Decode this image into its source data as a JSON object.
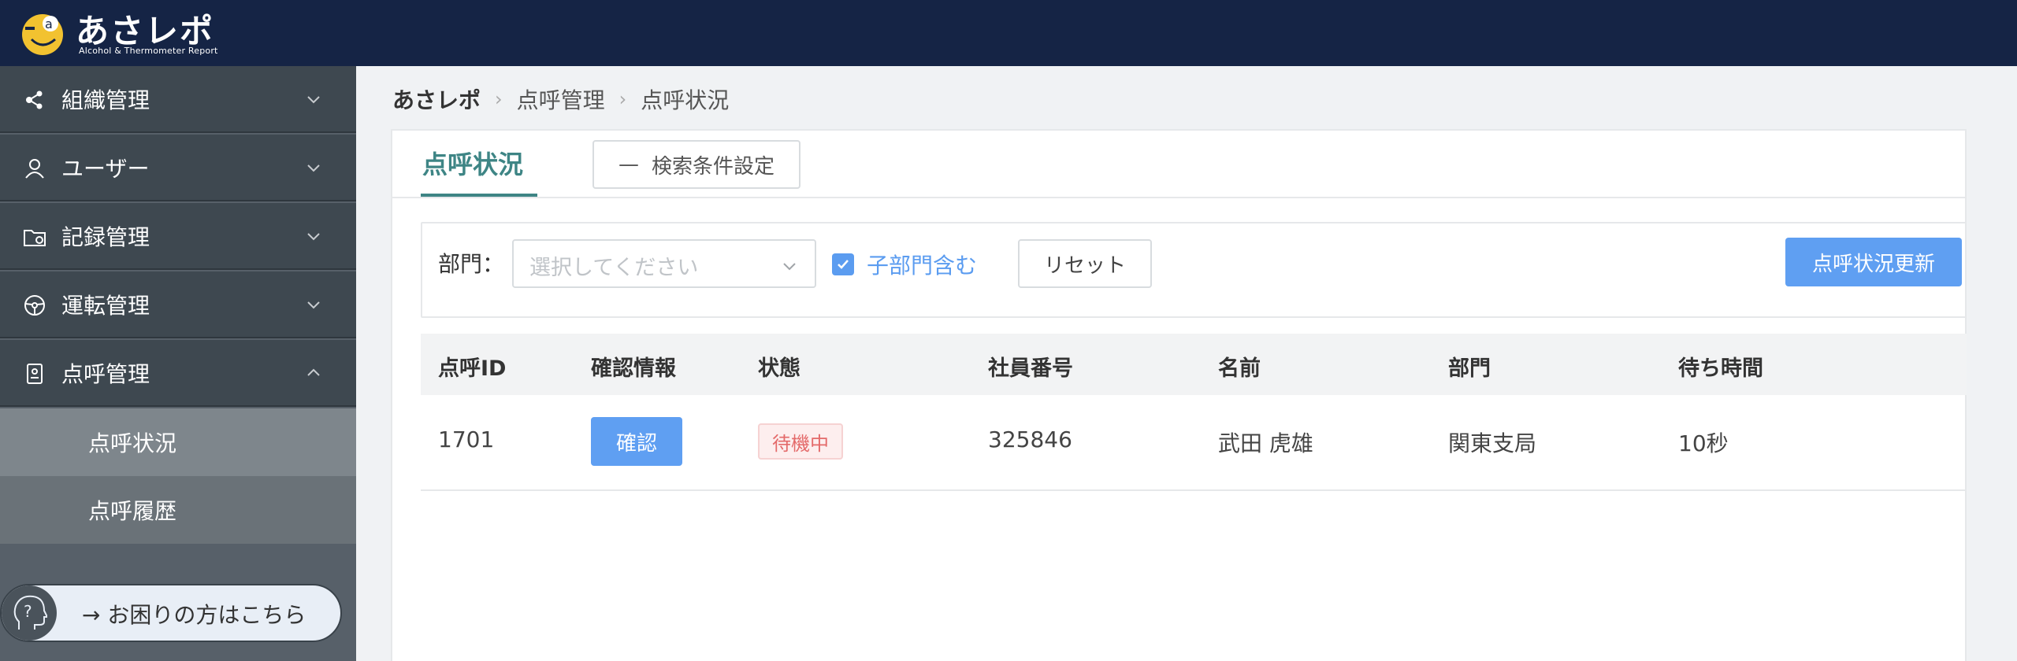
{
  "header": {
    "app_title": "あさレポ",
    "app_subtitle": "Alcohol & Thermometer Report",
    "logo_icon": "asarepo-logo"
  },
  "sidebar": {
    "items": [
      {
        "label": "組織管理",
        "icon": "organization-icon",
        "expanded": false
      },
      {
        "label": "ユーザー",
        "icon": "user-icon",
        "expanded": false
      },
      {
        "label": "記録管理",
        "icon": "folder-settings-icon",
        "expanded": false
      },
      {
        "label": "運転管理",
        "icon": "steering-wheel-icon",
        "expanded": false
      },
      {
        "label": "点呼管理",
        "icon": "id-badge-icon",
        "expanded": true
      }
    ],
    "subitems": [
      {
        "label": "点呼状況",
        "active": true
      },
      {
        "label": "点呼履歴",
        "active": false
      }
    ],
    "help": {
      "label": "→ お困りの方はこちら",
      "icon": "help-head-icon"
    }
  },
  "breadcrumb": [
    "あさレポ",
    "点呼管理",
    "点呼状況"
  ],
  "main": {
    "tab_label": "点呼状況",
    "search_settings_label": "検索条件設定",
    "filter": {
      "dept_label": "部門：",
      "dept_placeholder": "選択してください",
      "include_sub_label": "子部門含む",
      "include_sub_checked": true,
      "reset_label": "リセット",
      "refresh_label": "点呼状況更新"
    },
    "table": {
      "headers": [
        "点呼ID",
        "確認情報",
        "状態",
        "社員番号",
        "名前",
        "部門",
        "待ち時間"
      ],
      "rows": [
        {
          "id": "1701",
          "confirm_label": "確認",
          "status": "待機中",
          "employee_no": "325846",
          "name": "武田 虎雄",
          "department": "関東支局",
          "wait_time": "10秒"
        }
      ]
    }
  },
  "colors": {
    "header_bg": "#152445",
    "sidebar_bg": "#3e4850",
    "accent": "#3e8585",
    "primary_button": "#5f9ff2",
    "status_waiting": "#e46a6a"
  }
}
